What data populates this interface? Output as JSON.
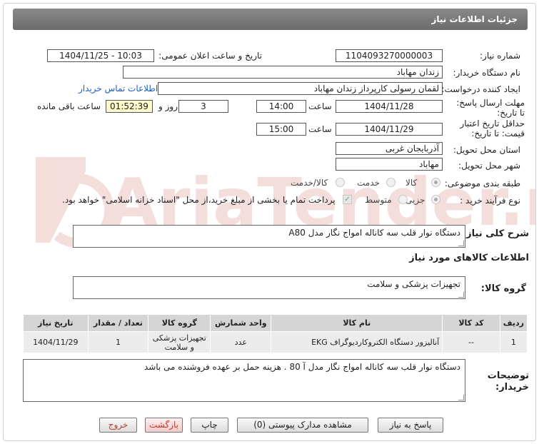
{
  "header": {
    "title": "جزئیات اطلاعات نیاز"
  },
  "fields": {
    "need_number_label": "شماره نیاز:",
    "need_number": "1104093270000003",
    "announce_label": "تاریخ و ساعت اعلان عمومی:",
    "announce_value": "1404/11/25 - 10:03",
    "buyer_label": "نام دستگاه خریدار:",
    "buyer_value": "زندان مهاباد",
    "creator_label": "ایجاد کننده درخواست:",
    "creator_value": "لقمان رسولی کارپرداز زندان مهاباد",
    "contact_link": "اطلاعات تماس خریدار",
    "deadline_label": "مهلت ارسال پاسخ: تا تاریخ:",
    "deadline_date": "1404/11/28",
    "time_label": "ساعت",
    "deadline_time": "14:00",
    "days_value": "3",
    "days_label": "روز و",
    "remaining_value": "01:52:39",
    "remaining_label": "ساعت باقی مانده",
    "validity_label": "حداقل تاریخ اعتبار قیمت: تا تاریخ:",
    "validity_date": "1404/11/29",
    "validity_time": "15:00",
    "province_label": "استان محل تحویل:",
    "province_value": "آذربایجان غربی",
    "city_label": "شهر محل تحویل:",
    "city_value": "مهاباد",
    "category_label": "طبقه بندی موضوعی:",
    "category_options": [
      "کالا",
      "خدمت",
      "کالا/خدمت"
    ],
    "process_label": "نوع فرآیند خرید :",
    "process_options": [
      "جزیی",
      "متوسط"
    ],
    "payment_note": "پرداخت تمام یا بخشی از مبلغ خرید،از محل \"اسناد خزانه اسلامی\" خواهد بود."
  },
  "description": {
    "label": "شرح کلی نیاز:",
    "value": "دستگاه نوار قلب سه کاناله امواج نگار مدل A80"
  },
  "goods_info": {
    "title": "اطلاعات کالاهای مورد نیاز",
    "group_label": "گروه کالا:",
    "group_value": "تجهیزات پزشکی و سلامت"
  },
  "table": {
    "headers": [
      "ردیف",
      "کد کالا",
      "نام کالا",
      "واحد شمارش",
      "گروه کالا",
      "تعداد / مقدار",
      "تاریخ نیاز"
    ],
    "rows": [
      {
        "row": "1",
        "code": "--",
        "name": "آنالیزور دستگاه الکتروکاردیوگراف EKG",
        "unit": "عدد",
        "group": "تجهیزات پزشکی و سلامت",
        "qty": "1",
        "date": "1404/11/29"
      }
    ]
  },
  "buyer_notes": {
    "label": "توضیحات خریدار:",
    "value": "دستگاه نوار قلب سه کاناله امواج نگار مدل آ 80 . هزینه حمل بر عهده فروشنده می باشد"
  },
  "buttons": {
    "reply": "پاسخ به نیاز",
    "attachments": "مشاهده مدارک پیوستی (0)",
    "print": "چاپ",
    "back": "بازگشت",
    "exit": "خروج"
  },
  "colors": {
    "title_bar": "#767676",
    "link": "#1f5fbf",
    "remaining_bg": "#fdf8c9"
  }
}
